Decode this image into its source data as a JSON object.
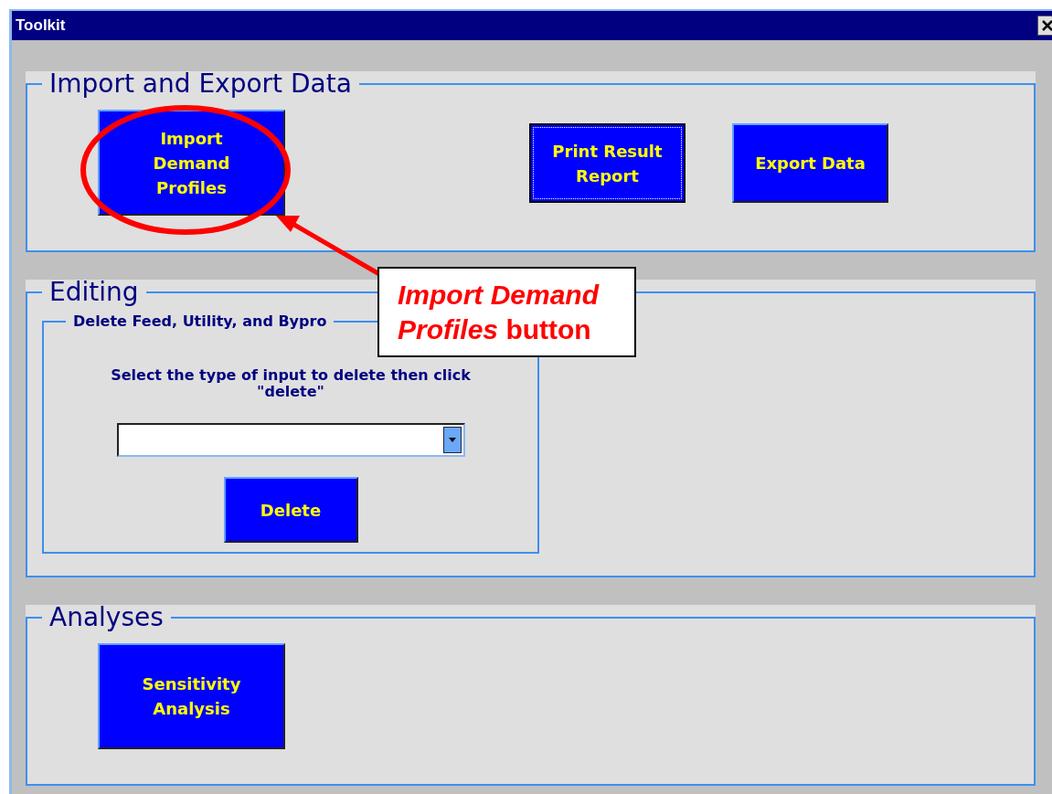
{
  "window": {
    "title": "Toolkit"
  },
  "groups": [
    {
      "kind": "buttons",
      "legend": "Import and Export Data",
      "buttons": [
        {
          "label": "Import Demand Profiles",
          "focused": false
        },
        {
          "label": "Print Result Report",
          "focused": true
        },
        {
          "label": "Export Data",
          "focused": false
        }
      ]
    },
    {
      "kind": "editing",
      "legend": "Editing",
      "subgroup": {
        "legend": "Delete Feed, Utility, and Bypro",
        "instruction": "Select the type of input to delete then click \"delete\"",
        "button": {
          "label": "Delete",
          "focused": false
        }
      }
    },
    {
      "kind": "buttons",
      "legend": "Analyses",
      "buttons": [
        {
          "label": "Sensitivity Analysis",
          "focused": false
        }
      ]
    }
  ],
  "annotation": {
    "text": "*Import Demand Profiles* button"
  }
}
